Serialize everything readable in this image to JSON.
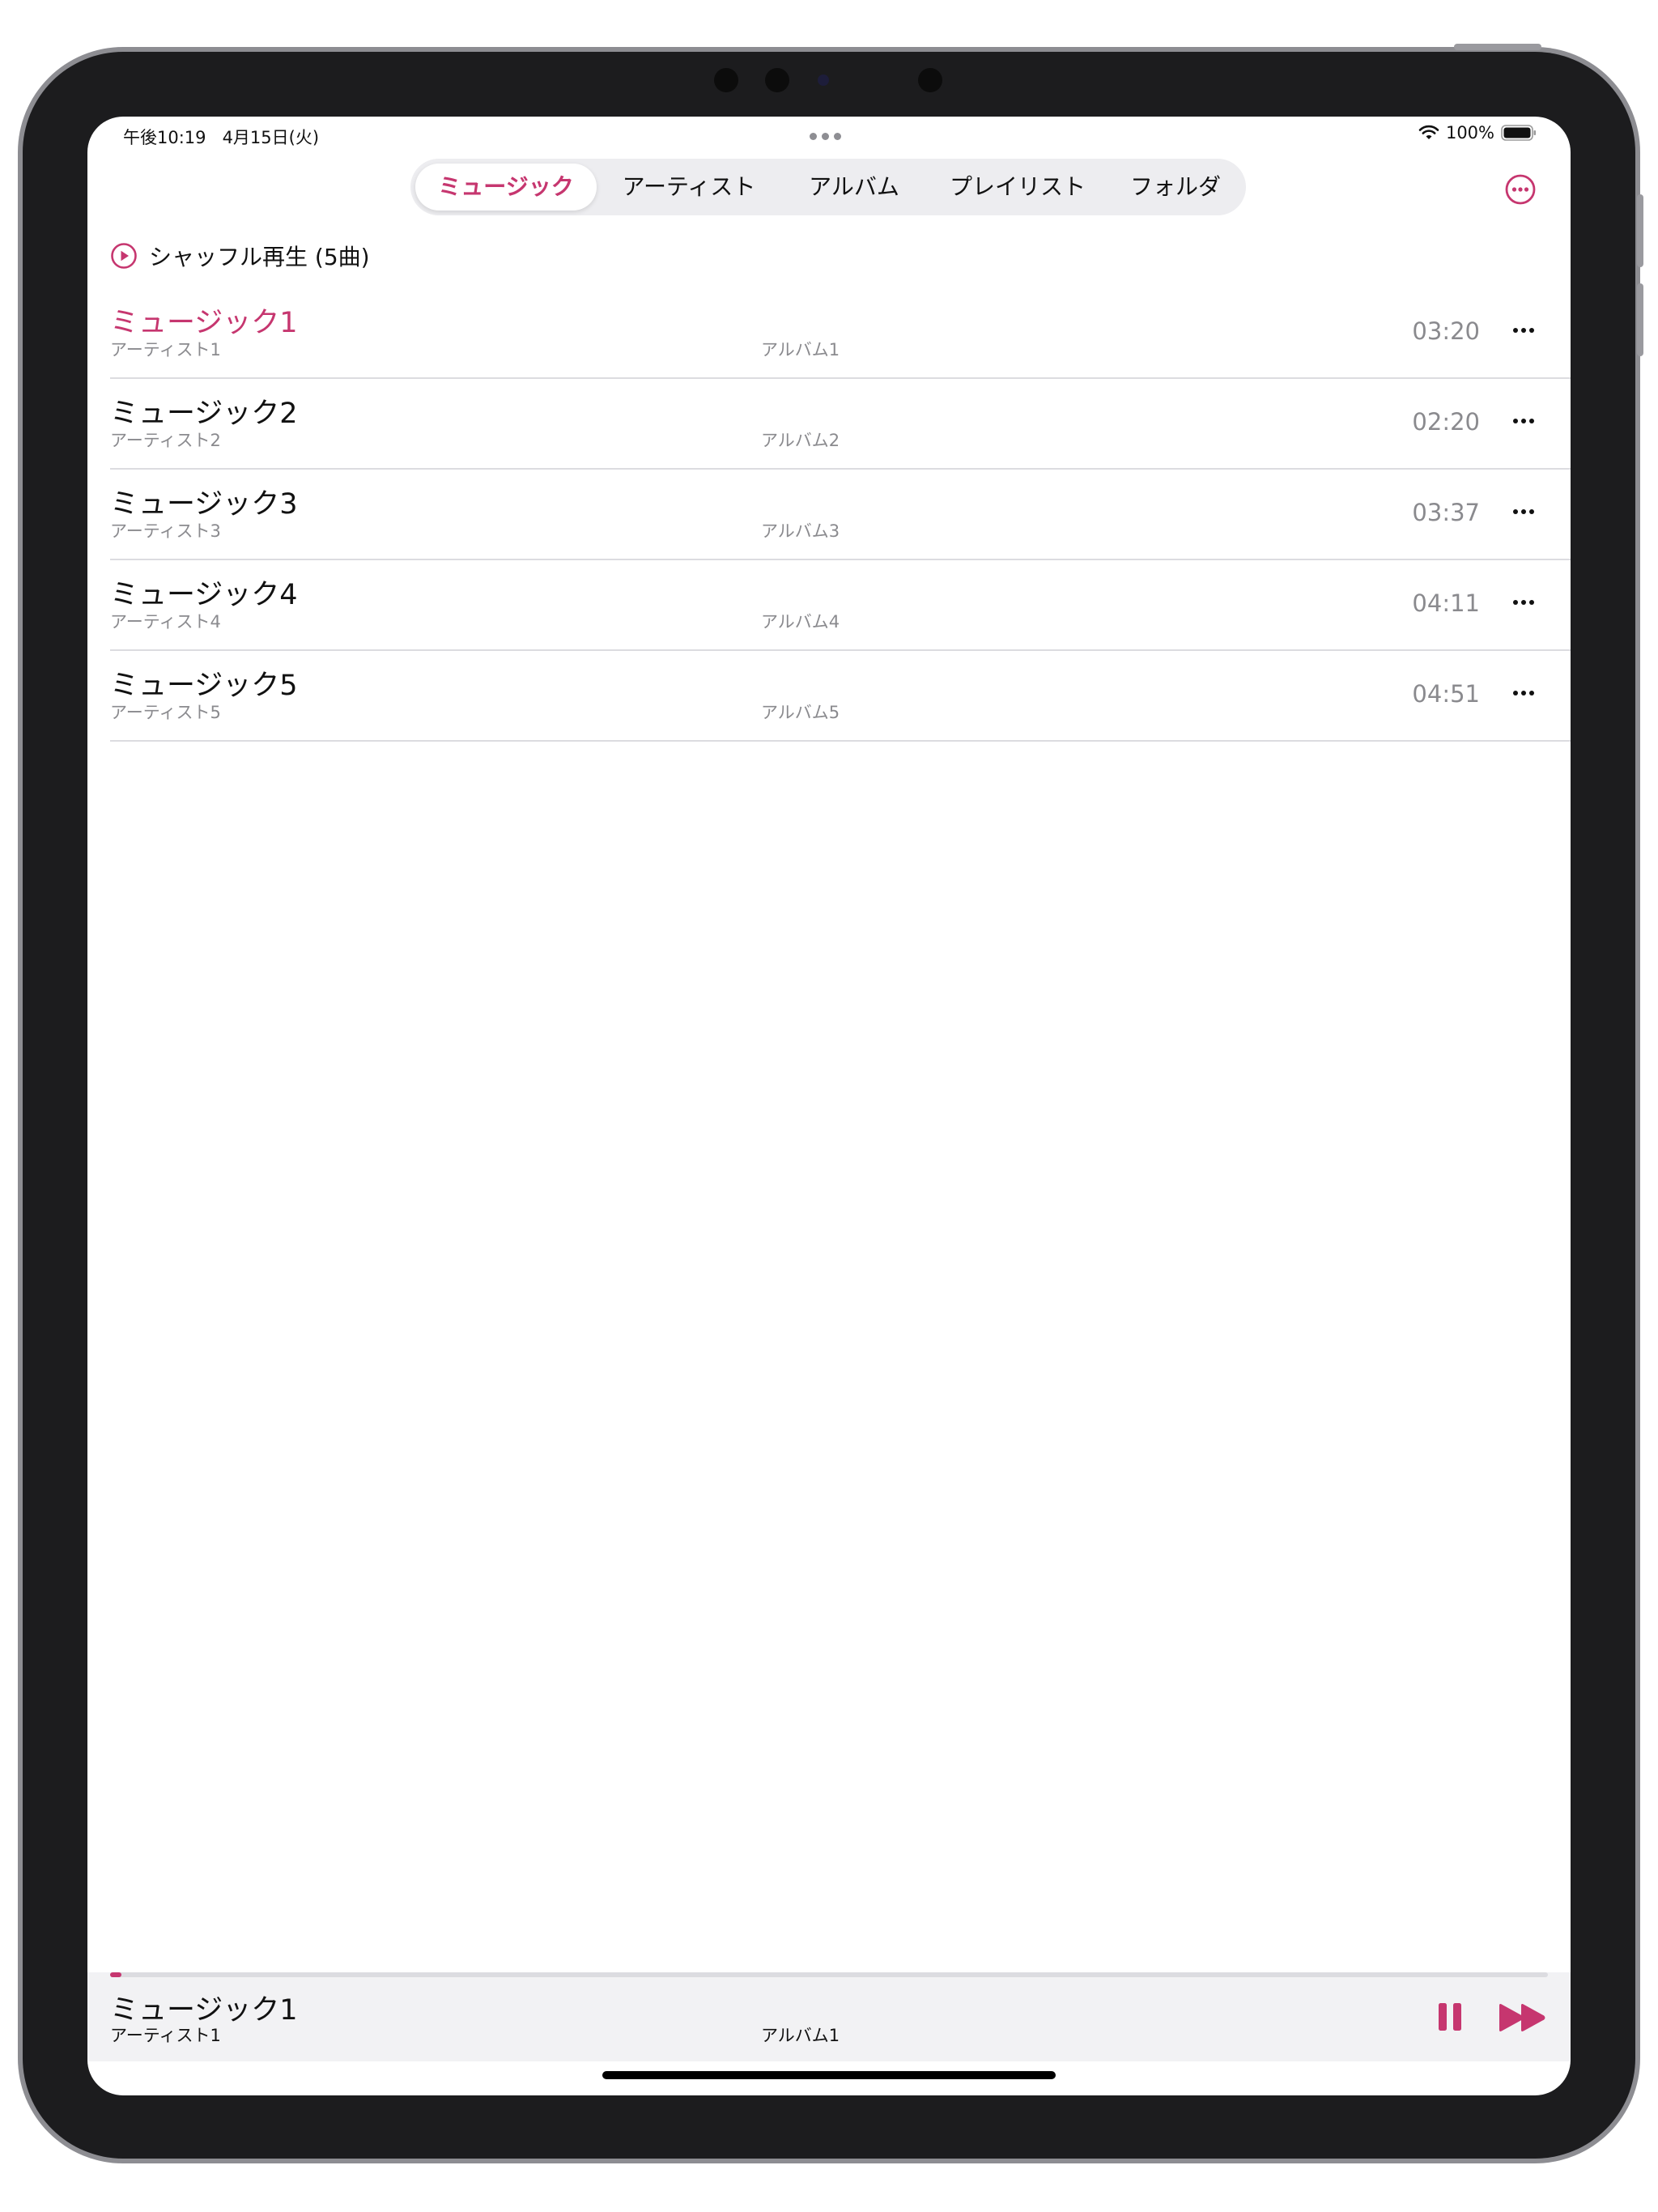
{
  "status_bar": {
    "time": "午後10:19",
    "date": "4月15日(火)",
    "battery": "100%"
  },
  "tabs": [
    {
      "label": "ミュージック",
      "active": true
    },
    {
      "label": "アーティスト",
      "active": false
    },
    {
      "label": "アルバム",
      "active": false
    },
    {
      "label": "プレイリスト",
      "active": false
    },
    {
      "label": "フォルダ",
      "active": false
    }
  ],
  "shuffle": {
    "label": "シャッフル再生 (5曲)"
  },
  "tracks": [
    {
      "title": "ミュージック1",
      "artist": "アーティスト1",
      "album": "アルバム1",
      "duration": "03:20"
    },
    {
      "title": "ミュージック2",
      "artist": "アーティスト2",
      "album": "アルバム2",
      "duration": "02:20"
    },
    {
      "title": "ミュージック3",
      "artist": "アーティスト3",
      "album": "アルバム3",
      "duration": "03:37"
    },
    {
      "title": "ミュージック4",
      "artist": "アーティスト4",
      "album": "アルバム4",
      "duration": "04:11"
    },
    {
      "title": "ミュージック5",
      "artist": "アーティスト5",
      "album": "アルバム5",
      "duration": "04:51"
    }
  ],
  "now_playing": {
    "title": "ミュージック1",
    "artist": "アーティスト1",
    "album": "アルバム1",
    "progress": 0.008
  },
  "colors": {
    "accent": "#c6366f",
    "secondary_text": "#8a8a8e",
    "player_bg": "#f2f2f4"
  },
  "icons": {
    "shuffle": "play-circle-icon",
    "more_top": "ellipsis-circle-icon",
    "row_more": "ellipsis-icon",
    "pause": "pause-icon",
    "next": "forward-icon",
    "wifi": "wifi-icon",
    "battery": "battery-icon"
  }
}
